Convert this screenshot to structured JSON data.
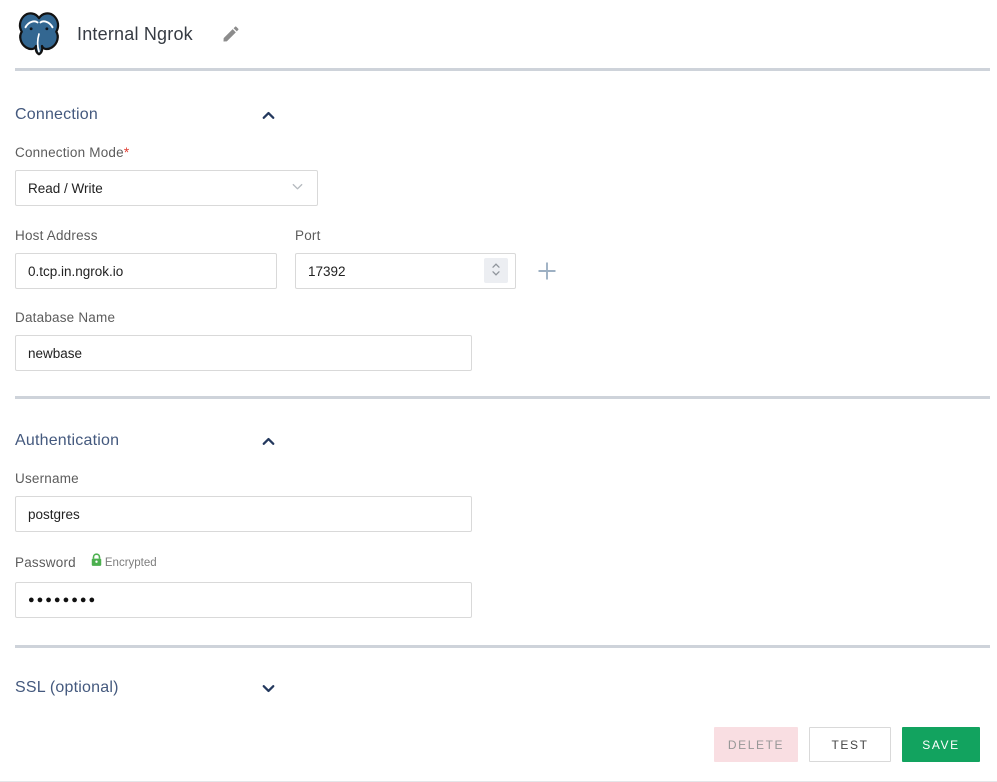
{
  "header": {
    "title": "Internal Ngrok",
    "logo_icon": "postgresql-elephant",
    "edit_icon": "pencil"
  },
  "sections": {
    "connection": {
      "title": "Connection",
      "state": "expanded",
      "collapse_icon": "chevron-up",
      "connection_mode": {
        "label": "Connection Mode",
        "required_mark": "*",
        "value": "Read / Write",
        "dropdown_icon": "chevron-down"
      },
      "host": {
        "label": "Host Address",
        "value": "0.tcp.in.ngrok.io"
      },
      "port": {
        "label": "Port",
        "value": "17392",
        "stepper_icon": "up-down-chevrons"
      },
      "add_icon": "plus",
      "database": {
        "label": "Database Name",
        "value": "newbase"
      }
    },
    "authentication": {
      "title": "Authentication",
      "state": "expanded",
      "collapse_icon": "chevron-up",
      "username": {
        "label": "Username",
        "value": "postgres"
      },
      "password": {
        "label": "Password",
        "badge_icon": "lock",
        "badge_text": "Encrypted",
        "value": "●●●●●●●●"
      }
    },
    "ssl": {
      "title": "SSL (optional)",
      "state": "collapsed",
      "expand_icon": "chevron-down"
    }
  },
  "footer": {
    "delete_label": "DELETE",
    "test_label": "TEST",
    "save_label": "SAVE"
  },
  "colors": {
    "logo_blue": "#336791",
    "section_title": "#44597E",
    "divider": "#CED3DA",
    "required_red": "#E03C31",
    "encrypted_green": "#4CB04F",
    "save_green": "#12A35F",
    "delete_bg": "#F9DEE2"
  }
}
